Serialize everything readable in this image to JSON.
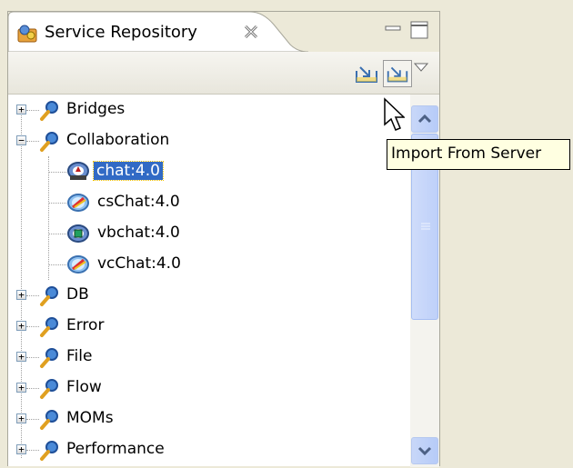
{
  "view": {
    "title": "Service Repository",
    "tab_icon": "service-repository-icon",
    "close_icon": "close-icon",
    "minimize_icon": "minimize-icon",
    "maximize_icon": "maximize-icon"
  },
  "toolbar": {
    "buttons": [
      {
        "icon": "import-icon"
      },
      {
        "icon": "import-from-server-icon",
        "hovered": true
      }
    ],
    "view_menu_icon": "view-menu-chevron-icon"
  },
  "tooltip": {
    "text": "Import From Server"
  },
  "tree": {
    "items": [
      {
        "label": "Bridges",
        "expander": "+"
      },
      {
        "label": "Collaboration",
        "expander": "−",
        "expanded": true,
        "children": [
          {
            "label": "chat:4.0",
            "icon": "chat-service-icon",
            "selected": true
          },
          {
            "label": "csChat:4.0",
            "icon": "cschat-service-icon"
          },
          {
            "label": "vbchat:4.0",
            "icon": "vbchat-service-icon"
          },
          {
            "label": "vcChat:4.0",
            "icon": "vcchat-service-icon"
          }
        ]
      },
      {
        "label": "DB",
        "expander": "+"
      },
      {
        "label": "Error",
        "expander": "+"
      },
      {
        "label": "File",
        "expander": "+"
      },
      {
        "label": "Flow",
        "expander": "+"
      },
      {
        "label": "MOMs",
        "expander": "+"
      },
      {
        "label": "Performance",
        "expander": "+"
      }
    ]
  },
  "colors": {
    "selection": "#316ac5",
    "tooltip_bg": "#ffffe1",
    "scrollbar": "#c1d3fb"
  }
}
